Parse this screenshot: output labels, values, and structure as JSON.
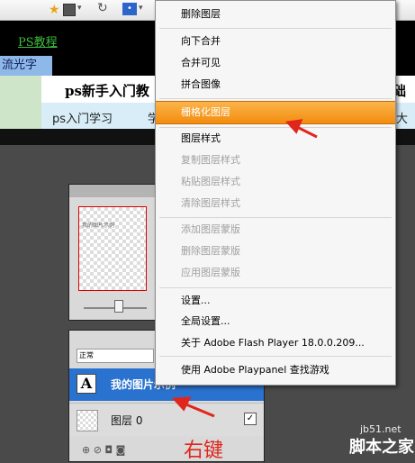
{
  "browser": {
    "star": "★",
    "qr_caret": "▾",
    "refresh": "↻",
    "paw": "🐾",
    "paw_caret": "▾"
  },
  "webpage": {
    "ps_link": "PS教程",
    "tag": "流光字",
    "title_left": "ps新手入门教",
    "title_right": "础教",
    "tabs": [
      "ps入门学习",
      "学",
      "大频"
    ]
  },
  "menu": {
    "items": [
      {
        "label": "删除图层",
        "enabled": true
      },
      {
        "label": "向下合并",
        "enabled": true
      },
      {
        "label": "合并可见",
        "enabled": true
      },
      {
        "label": "拼合图像",
        "enabled": true
      },
      {
        "label": "栅格化图层",
        "enabled": true,
        "highlighted": true
      },
      {
        "label": "图层样式",
        "enabled": true
      },
      {
        "label": "复制图层样式",
        "enabled": false
      },
      {
        "label": "粘贴图层样式",
        "enabled": false
      },
      {
        "label": "清除图层样式",
        "enabled": false
      },
      {
        "label": "添加图层蒙版",
        "enabled": false
      },
      {
        "label": "删除图层蒙版",
        "enabled": false
      },
      {
        "label": "应用图层蒙版",
        "enabled": false
      },
      {
        "label": "设置...",
        "enabled": true
      },
      {
        "label": "全局设置...",
        "enabled": true
      },
      {
        "label": "关于 Adobe Flash Player 18.0.0.209...",
        "enabled": true
      },
      {
        "label": "使用 Adobe Playpanel 查找游戏",
        "enabled": true
      }
    ]
  },
  "panels": {
    "navigator_text": "我的图片示例",
    "blend_mode": "正常",
    "layer_text_icon": "A",
    "layer_text_name": "我的图片示例",
    "layer_bg_name": "图层 0",
    "check": "✓",
    "bottom_icons": "⊕ ⊘ ◘ ◙"
  },
  "annotations": {
    "right_click": "右键",
    "watermark_url": "jb51.net",
    "watermark_name": "脚本之家"
  },
  "colors": {
    "highlight": "#f28c0e",
    "arrow": "#e0261c",
    "layer_selected": "#2a72cf"
  }
}
